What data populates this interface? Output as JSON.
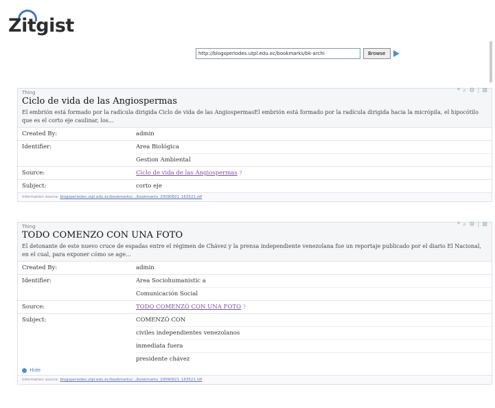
{
  "app": {
    "title": "Zitgist"
  },
  "browse": {
    "url_value": "http://blogsperiodes.utpl.edu.ec/bookmarks/bk-archi",
    "button_label": "Browse"
  },
  "panels": [
    {
      "type": "Thing",
      "title": "Ciclo de vida de las Angiospermas",
      "description": "El embrión está formado por la radícula dirigida Ciclo de vida de las AngiospermasEl embrión está formado por la radícula dirigida hacia la micrópila, el hipocótilo que es el corto eje caulinar, los...",
      "tools": {
        "tag": "*",
        "search": "⌕",
        "gear": "⚙",
        "sep": "|",
        "close": "⊠"
      },
      "props": [
        {
          "name": "Created By:",
          "values": [
            "admin"
          ]
        },
        {
          "name": "Identifier:",
          "values": [
            "Area Biológica",
            "Gestion Ambiental"
          ]
        },
        {
          "name": "Source:",
          "values": [
            "Ciclo de vida de las Angiospermas"
          ]
        },
        {
          "name": "Subject:",
          "values": [
            "corto eje"
          ]
        }
      ],
      "info_prefix": "Information source:",
      "info_link": "blogsperiodes.utpl.edu.ec/bookmarks/.../bookmarks_20090821_163521.rdf"
    },
    {
      "type": "Thing",
      "title": "TODO COMENZO CON UNA FOTO",
      "description": "El detonante de este nuevo cruce de espadas entre el régimen de Chávez y la prensa independiente venezolana fue un reportaje publicado por el diario El Nacional, en el cual, para exponer cómo se age...",
      "tools": {
        "tag": "*",
        "search": "⌕",
        "gear": "⚙",
        "sep": "|",
        "close": "⊠"
      },
      "props": [
        {
          "name": "Created By:",
          "values": [
            "admin"
          ]
        },
        {
          "name": "Identifier:",
          "values": [
            "Area Sociohumanistic a",
            "Comunicación Social"
          ]
        },
        {
          "name": "Source:",
          "values": [
            "TODO COMENZÓ CON UNA FOTO"
          ]
        },
        {
          "name": "Subject:",
          "values": [
            "COMENZÓ CON",
            "civiles independientes venezolanos",
            "inmediata fuera",
            "presidente chávez"
          ]
        }
      ],
      "hide_label": "Hide",
      "info_prefix": "Information source:",
      "info_link": "blogsperiodes.utpl.edu.ec/bookmarks/.../bookmarks_20090821_163521.rdf"
    }
  ]
}
